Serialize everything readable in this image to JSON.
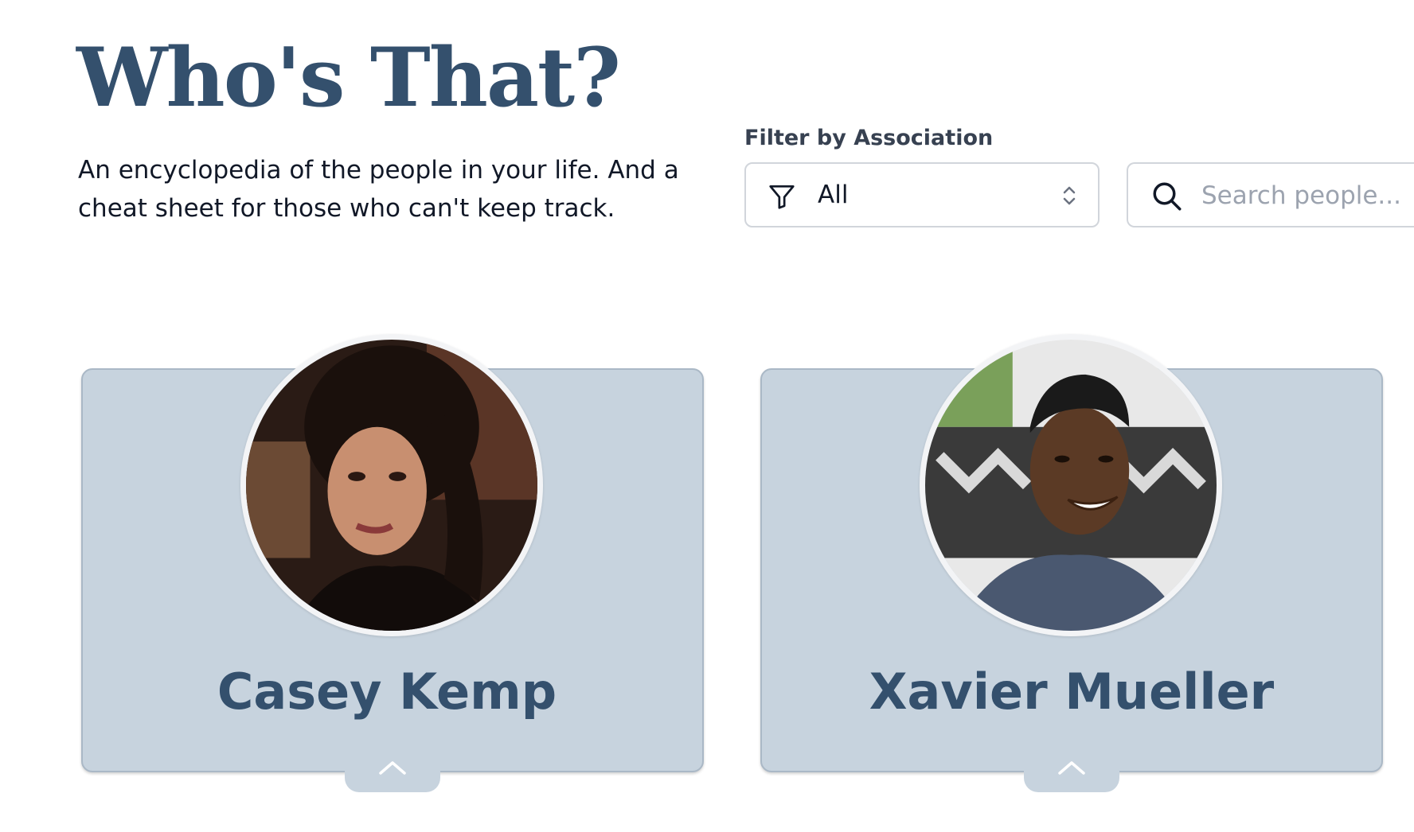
{
  "header": {
    "title": "Who's That?",
    "tagline": "An encyclopedia of the people in your life. And a cheat sheet for those who can't keep track."
  },
  "filter": {
    "label": "Filter by Association",
    "selected": "All",
    "icon": "funnel-icon"
  },
  "search": {
    "placeholder": "Search people...",
    "icon": "search-icon"
  },
  "people": [
    {
      "name": "Casey Kemp"
    },
    {
      "name": "Xavier Mueller"
    }
  ],
  "colors": {
    "brand": "#34506d",
    "card_background": "#c7d3de",
    "avatar_ring": "#f3f4f6"
  }
}
